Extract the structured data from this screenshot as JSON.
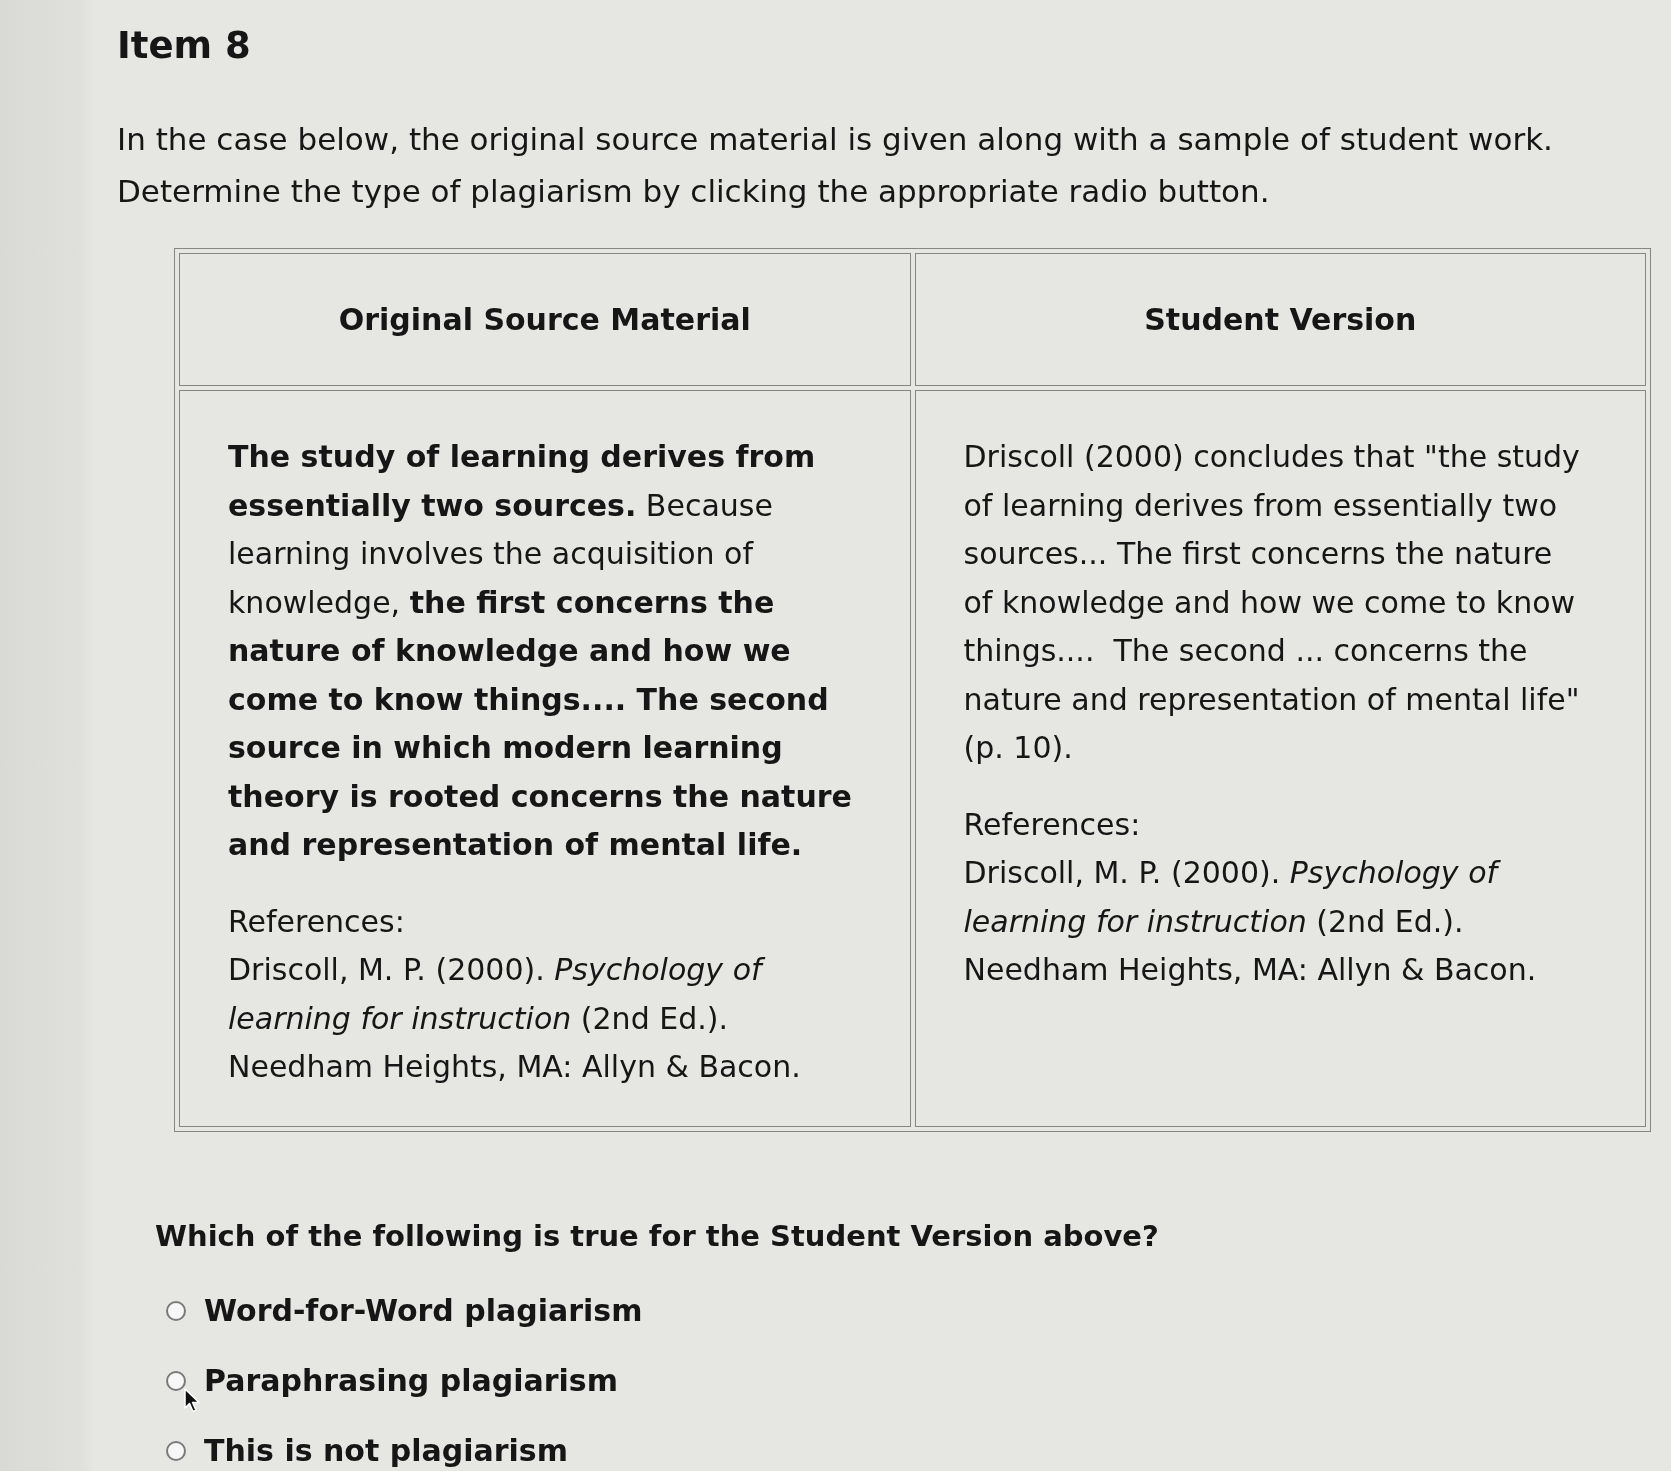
{
  "item": {
    "title": "Item 8",
    "instructions": [
      "In the case below, the original source material is given along with a sample of student work.",
      "Determine the type of plagiarism by clicking the appropriate radio button."
    ]
  },
  "table": {
    "columns": [
      "Original Source Material",
      "Student Version"
    ],
    "cells": [
      {
        "passage": "**The study of learning derives from essentially two sources.** Because learning involves the acquisition of knowledge, **the first concerns the nature of knowledge and how we come to know things.... The second source in which modern learning theory is rooted concerns the nature and representation of mental life.**",
        "references_label": "References:",
        "reference": "Driscoll, M. P. (2000). *Psychology of learning for instruction* (2nd Ed.). Needham Heights, MA: Allyn & Bacon."
      },
      {
        "passage": "Driscoll (2000) concludes that \"the study of learning derives from essentially two sources... The first concerns the nature of knowledge and how we come to know things....  The second ... concerns the nature and representation of mental life\" (p. 10).",
        "references_label": "References:",
        "reference": "Driscoll, M. P. (2000). *Psychology of learning for instruction* (2nd Ed.). Needham Heights, MA: Allyn & Bacon."
      }
    ]
  },
  "question": {
    "text": "Which of the following is true for the Student Version above?",
    "options": [
      {
        "label": "Word-for-Word plagiarism",
        "selected": false
      },
      {
        "label": "Paraphrasing plagiarism",
        "selected": false
      },
      {
        "label": "This is not plagiarism",
        "selected": false
      }
    ]
  }
}
